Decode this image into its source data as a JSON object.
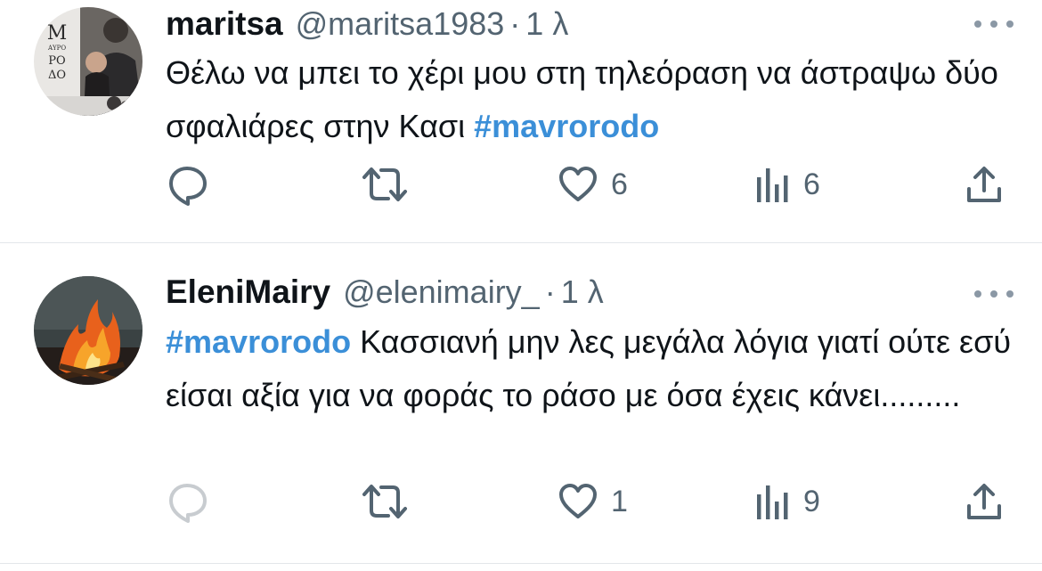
{
  "tweets": [
    {
      "name": "maritsa",
      "handle": "@maritsa1983",
      "separator": "·",
      "time": "1 λ",
      "text": "Θέλω να μπει το χέρι μου στη τηλεόραση να άστραψω δύο σφαλιάρες στην Κασι ",
      "hashtag_end": "#mavrorodo",
      "avatar_logo_text": [
        "Μ",
        "ΑΥΡΟ",
        "ΡΟ",
        "ΔΟ"
      ],
      "actions": {
        "reply_icon": "reply-icon",
        "retweet_icon": "retweet-icon",
        "like_icon": "heart-icon",
        "like_count": "6",
        "views_icon": "analytics-icon",
        "views_count": "6",
        "share_icon": "share-icon"
      }
    },
    {
      "name": "EleniMairy",
      "handle": "@elenimairy_",
      "separator": "·",
      "time": "1 λ",
      "hashtag_start": "#mavrorodo",
      "text": " Κασσιανή μην λες μεγάλα λόγια γιατί ούτε εσύ είσαι αξία για να φοράς το ράσο με όσα έχεις κάνει.........",
      "actions": {
        "reply_icon": "reply-icon",
        "retweet_icon": "retweet-icon",
        "like_icon": "heart-icon",
        "like_count": "1",
        "views_icon": "analytics-icon",
        "views_count": "9",
        "share_icon": "share-icon"
      }
    }
  ],
  "colors": {
    "hashtag": "#3b8fd8",
    "secondary_text": "#536471",
    "icon": "#536471",
    "reply_icon_faded": "#c8ccd0",
    "divider": "#e3e6ea"
  }
}
